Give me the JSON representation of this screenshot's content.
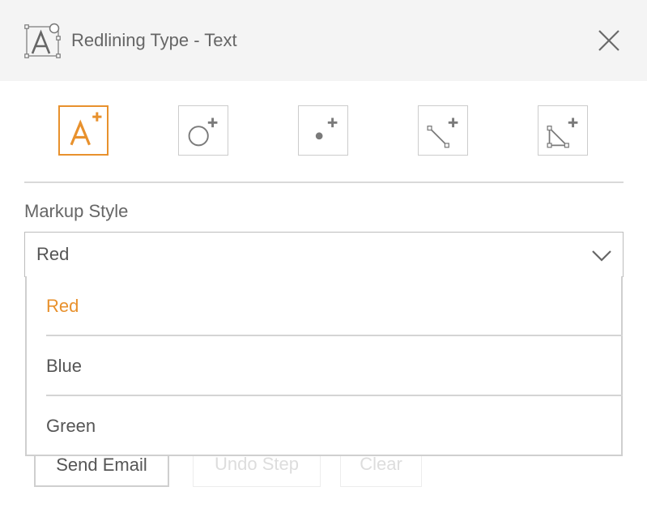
{
  "dialog": {
    "title": "Redlining Type - Text",
    "header_icon": "text-redline-icon",
    "close_icon": "close-icon"
  },
  "tools": [
    {
      "name": "add-text-tool",
      "icon": "text-add-icon",
      "active": true
    },
    {
      "name": "add-circle-tool",
      "icon": "circle-add-icon",
      "active": false
    },
    {
      "name": "add-point-tool",
      "icon": "point-add-icon",
      "active": false
    },
    {
      "name": "add-line-tool",
      "icon": "line-add-icon",
      "active": false
    },
    {
      "name": "add-polygon-tool",
      "icon": "polygon-add-icon",
      "active": false
    }
  ],
  "markup_style": {
    "label": "Markup Style",
    "selected": "Red",
    "options": [
      "Red",
      "Blue",
      "Green"
    ]
  },
  "actions": {
    "send_email": "Send Email",
    "undo_step": "Undo Step",
    "clear": "Clear"
  },
  "colors": {
    "accent": "#e8912d",
    "header_bg": "#f4f4f4",
    "text": "#555555",
    "disabled_text": "#dddddd",
    "border": "#cccccc"
  }
}
